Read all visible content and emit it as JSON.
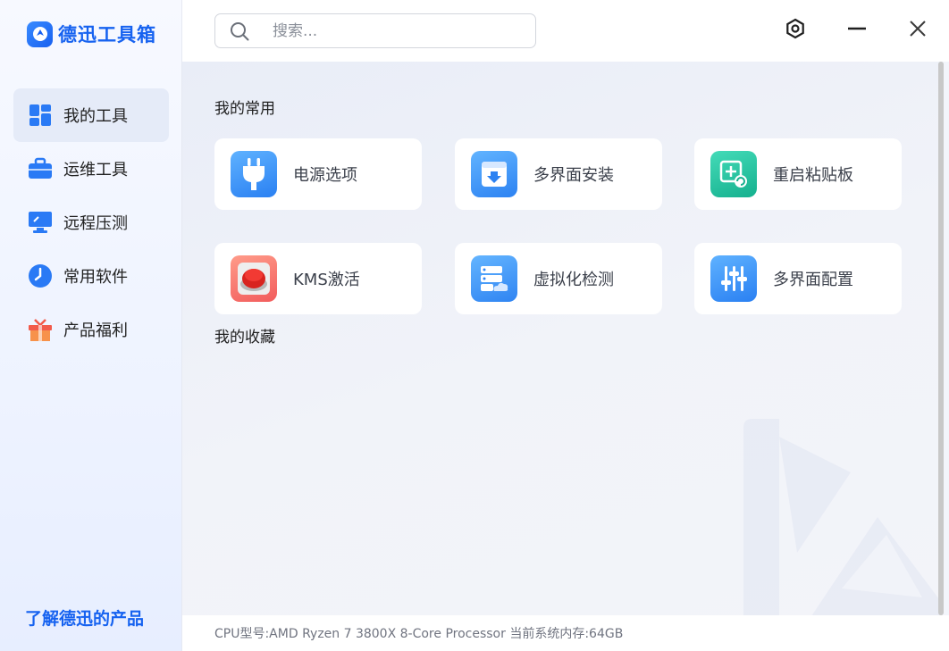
{
  "brand": {
    "name": "德迅工具箱"
  },
  "sidebar": {
    "items": [
      {
        "label": "我的工具",
        "icon": "grid-icon",
        "active": true
      },
      {
        "label": "运维工具",
        "icon": "toolbox-icon",
        "active": false
      },
      {
        "label": "远程压测",
        "icon": "monitor-icon",
        "active": false
      },
      {
        "label": "常用软件",
        "icon": "clock-icon",
        "active": false
      },
      {
        "label": "产品福利",
        "icon": "gift-icon",
        "active": false
      }
    ],
    "footer_link": "了解德迅的产品"
  },
  "search": {
    "placeholder": "搜索...",
    "value": ""
  },
  "window_controls": {
    "settings": "gear-icon",
    "minimize": "minimize-icon",
    "close": "close-icon"
  },
  "main": {
    "favorites_title": "我的常用",
    "collection_title": "我的收藏",
    "tools": [
      {
        "label": "电源选项",
        "icon": "power-plug-icon",
        "color": "#2f8cf5"
      },
      {
        "label": "多界面安装",
        "icon": "download-box-icon",
        "color": "#3b8cf2"
      },
      {
        "label": "重启粘贴板",
        "icon": "clipboard-refresh-icon",
        "color": "#22c2a0"
      },
      {
        "label": "KMS激活",
        "icon": "red-button-icon",
        "color": "#f05a5a"
      },
      {
        "label": "虚拟化检测",
        "icon": "server-cloud-icon",
        "color": "#3d8ff2"
      },
      {
        "label": "多界面配置",
        "icon": "sliders-icon",
        "color": "#2f8cf5"
      }
    ]
  },
  "status": {
    "text": "CPU型号:AMD Ryzen 7 3800X 8-Core Processor 当前系统内存:64GB"
  },
  "colors": {
    "accent": "#1662f0",
    "active_nav_bg": "#e5ebf8"
  }
}
